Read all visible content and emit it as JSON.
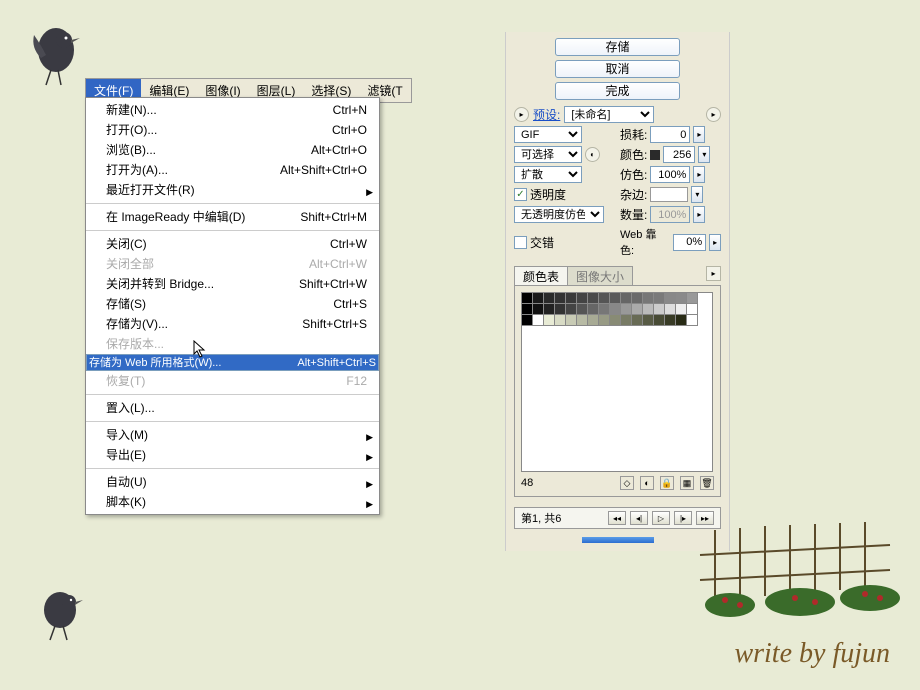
{
  "menubar": [
    {
      "label": "文件(F)",
      "active": true
    },
    {
      "label": "编辑(E)"
    },
    {
      "label": "图像(I)"
    },
    {
      "label": "图层(L)"
    },
    {
      "label": "选择(S)"
    },
    {
      "label": "滤镜(T"
    }
  ],
  "menu": {
    "items": [
      {
        "t": "item",
        "label": "新建(N)...",
        "sc": "Ctrl+N"
      },
      {
        "t": "item",
        "label": "打开(O)...",
        "sc": "Ctrl+O"
      },
      {
        "t": "item",
        "label": "浏览(B)...",
        "sc": "Alt+Ctrl+O"
      },
      {
        "t": "item",
        "label": "打开为(A)...",
        "sc": "Alt+Shift+Ctrl+O"
      },
      {
        "t": "sub",
        "label": "最近打开文件(R)"
      },
      {
        "t": "sep"
      },
      {
        "t": "item",
        "label": "在 ImageReady 中编辑(D)",
        "sc": "Shift+Ctrl+M"
      },
      {
        "t": "sep"
      },
      {
        "t": "item",
        "label": "关闭(C)",
        "sc": "Ctrl+W"
      },
      {
        "t": "item",
        "label": "关闭全部",
        "sc": "Alt+Ctrl+W",
        "dis": true
      },
      {
        "t": "item",
        "label": "关闭并转到 Bridge...",
        "sc": "Shift+Ctrl+W"
      },
      {
        "t": "item",
        "label": "存储(S)",
        "sc": "Ctrl+S"
      },
      {
        "t": "item",
        "label": "存储为(V)...",
        "sc": "Shift+Ctrl+S"
      },
      {
        "t": "item",
        "label": "保存版本...",
        "dis": true
      },
      {
        "t": "item",
        "label": "存储为 Web 所用格式(W)...",
        "sc": "Alt+Shift+Ctrl+S",
        "sel": true
      },
      {
        "t": "item",
        "label": "恢复(T)",
        "sc": "F12",
        "dis": true
      },
      {
        "t": "sep"
      },
      {
        "t": "item",
        "label": "置入(L)..."
      },
      {
        "t": "sep"
      },
      {
        "t": "sub",
        "label": "导入(M)"
      },
      {
        "t": "sub",
        "label": "导出(E)"
      },
      {
        "t": "sep"
      },
      {
        "t": "sub",
        "label": "自动(U)"
      },
      {
        "t": "sub",
        "label": "脚本(K)"
      }
    ]
  },
  "panel": {
    "buttons": {
      "save": "存储",
      "cancel": "取消",
      "done": "完成"
    },
    "preset": {
      "label": "预设:",
      "value": "[未命名]"
    },
    "format": {
      "value": "GIF",
      "loss_label": "损耗:",
      "loss_value": "0"
    },
    "reduction": {
      "value": "可选择",
      "colors_label": "颜色:",
      "colors_value": "256"
    },
    "dither": {
      "value": "扩散",
      "amt_label": "仿色:",
      "amt_value": "100%"
    },
    "trans": {
      "label": "透明度",
      "checked": true,
      "matte_label": "杂边:"
    },
    "trans2": {
      "value": "无透明度仿色",
      "amt_label": "数量:",
      "amt_value": "100%"
    },
    "inter": {
      "label": "交错",
      "checked": false,
      "snap_label": "Web 靠色:",
      "snap_value": "0%"
    },
    "tabs": {
      "t1": "颜色表",
      "t2": "图像大小"
    },
    "ctable": {
      "count": "48"
    },
    "nav": {
      "label": "第1, 共6"
    }
  },
  "signature": "write by fujun"
}
